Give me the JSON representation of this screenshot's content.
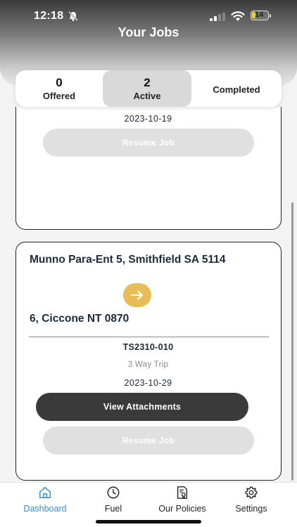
{
  "status_bar": {
    "time": "12:18",
    "battery": "14"
  },
  "header": {
    "title": "Your Jobs"
  },
  "tabs": [
    {
      "count": "0",
      "label": "Offered"
    },
    {
      "count": "2",
      "label": "Active"
    },
    {
      "count": "",
      "label": "Completed"
    }
  ],
  "jobs": [
    {
      "date": "2023-10-19",
      "resume_label": "Resume Job"
    },
    {
      "origin": "Munno Para-Ent 5, Smithfield SA 5114",
      "destination": "6, Ciccone NT 0870",
      "job_id": "TS2310-010",
      "trip_type": "3 Way Trip",
      "date": "2023-10-29",
      "attachments_label": "View Attachments",
      "resume_label": "Resume Job"
    }
  ],
  "nav": [
    {
      "label": "Dashboard",
      "icon": "home-icon"
    },
    {
      "label": "Fuel",
      "icon": "clock-icon"
    },
    {
      "label": "Our Policies",
      "icon": "policy-document-icon"
    },
    {
      "label": "Settings",
      "icon": "gear-icon"
    }
  ],
  "colors": {
    "accent": "#2f8fd6",
    "arrow": "#e9bd55",
    "dark_button": "#3a3a3a",
    "disabled_button": "#e0e0e0"
  }
}
